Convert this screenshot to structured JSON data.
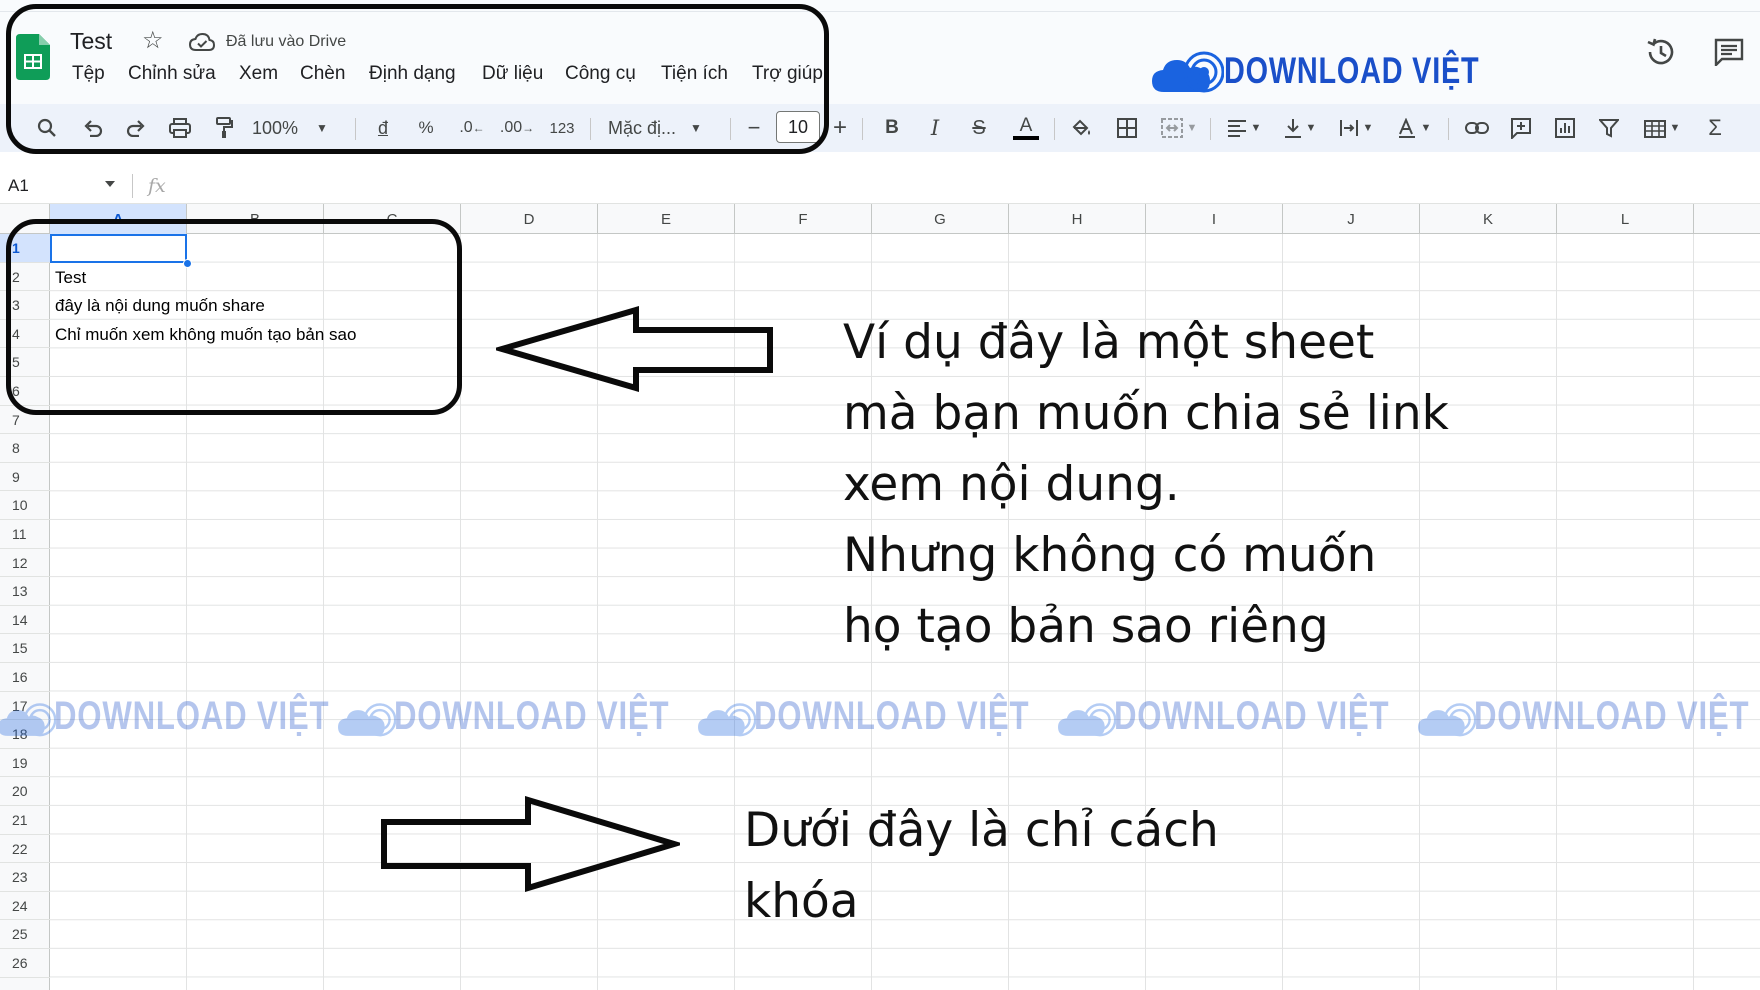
{
  "document": {
    "title": "Test",
    "saved_status": "Đã lưu vào Drive"
  },
  "menu": [
    "Tệp",
    "Chỉnh sửa",
    "Xem",
    "Chèn",
    "Định dạng",
    "Dữ liệu",
    "Công cụ",
    "Tiện ích",
    "Trợ giúp"
  ],
  "brand": {
    "text": "DOWNLOAD VIỆT",
    "color": "#1a4fc9"
  },
  "toolbar": {
    "zoom": "100%",
    "currency_symbol": "đ",
    "percent_symbol": "%",
    "decrease_decimal": ".0",
    "increase_decimal": ".00",
    "number_format": "123",
    "font_family": "Mặc đị...",
    "font_size": "10",
    "minus": "−",
    "plus": "+",
    "bold": "B",
    "italic": "I",
    "strikethrough": "S",
    "text_color": "A",
    "sum": "Σ"
  },
  "formula_bar": {
    "cell_ref": "A1",
    "fx": "fx"
  },
  "grid": {
    "columns": [
      "A",
      "B",
      "C",
      "D",
      "E",
      "F",
      "G",
      "H",
      "I",
      "J",
      "K",
      "L"
    ],
    "rows": [
      "1",
      "2",
      "3",
      "4",
      "5",
      "6",
      "7",
      "8",
      "9",
      "10",
      "11",
      "12",
      "13",
      "14",
      "15",
      "16",
      "17",
      "18",
      "19",
      "20",
      "21",
      "22",
      "23",
      "24",
      "25",
      "26"
    ],
    "selected_cell": "A1",
    "cells": {
      "A2": "Test",
      "A3": "đây là nội dung muốn share",
      "A4": "Chỉ muốn xem không muốn tạo bản sao"
    }
  },
  "annotations": {
    "main_text": [
      "Ví dụ đây là một sheet",
      "mà bạn muốn chia sẻ link",
      "xem nội dung.",
      "Nhưng không có muốn",
      "họ tạo bản sao riêng"
    ],
    "bottom_text": [
      "Dưới đây là chỉ cách",
      "khóa"
    ]
  },
  "watermark": {
    "text": "DOWNLOAD VIỆT",
    "count": 5
  },
  "colors": {
    "sheets_green": "#0f9d58",
    "selection_blue": "#1a73e8",
    "brand_blue": "#1a4fc9"
  }
}
